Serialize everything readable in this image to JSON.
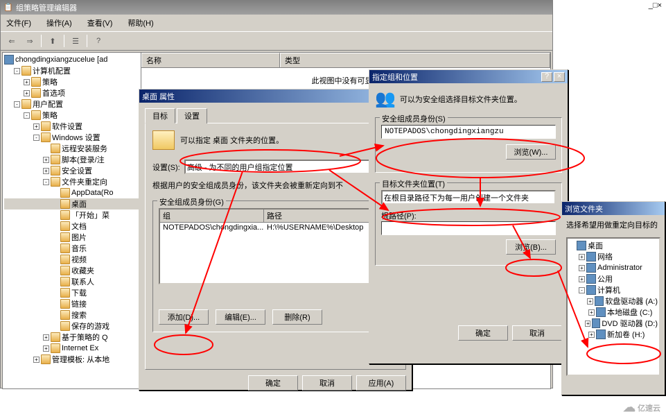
{
  "main_window": {
    "title": "组策略管理编辑器",
    "menubar": [
      "文件(F)",
      "操作(A)",
      "查看(V)",
      "帮助(H)"
    ],
    "win_buttons": {
      "min": "_",
      "max": "□",
      "close": "×"
    }
  },
  "tree": {
    "root": "chongdingxiangzucelue [ad",
    "items": [
      {
        "indent": 1,
        "toggle": "-",
        "label": "计算机配置",
        "icon": "computer"
      },
      {
        "indent": 2,
        "toggle": "+",
        "label": "策略",
        "icon": "folder"
      },
      {
        "indent": 2,
        "toggle": "+",
        "label": "首选项",
        "icon": "folder"
      },
      {
        "indent": 1,
        "toggle": "-",
        "label": "用户配置",
        "icon": "user"
      },
      {
        "indent": 2,
        "toggle": "-",
        "label": "策略",
        "icon": "folder"
      },
      {
        "indent": 3,
        "toggle": "+",
        "label": "软件设置",
        "icon": "folder"
      },
      {
        "indent": 3,
        "toggle": "-",
        "label": "Windows 设置",
        "icon": "folder"
      },
      {
        "indent": 4,
        "toggle": "",
        "label": "远程安装服务",
        "icon": "remote"
      },
      {
        "indent": 4,
        "toggle": "+",
        "label": "脚本(登录/注",
        "icon": "script"
      },
      {
        "indent": 4,
        "toggle": "+",
        "label": "安全设置",
        "icon": "security"
      },
      {
        "indent": 4,
        "toggle": "-",
        "label": "文件夹重定向",
        "icon": "folder"
      },
      {
        "indent": 5,
        "toggle": "",
        "label": "AppData(Ro",
        "icon": "folder"
      },
      {
        "indent": 5,
        "toggle": "",
        "label": "桌面",
        "icon": "folder",
        "selected": true
      },
      {
        "indent": 5,
        "toggle": "",
        "label": "「开始」菜",
        "icon": "folder"
      },
      {
        "indent": 5,
        "toggle": "",
        "label": "文档",
        "icon": "folder"
      },
      {
        "indent": 5,
        "toggle": "",
        "label": "图片",
        "icon": "folder"
      },
      {
        "indent": 5,
        "toggle": "",
        "label": "音乐",
        "icon": "folder"
      },
      {
        "indent": 5,
        "toggle": "",
        "label": "视频",
        "icon": "folder"
      },
      {
        "indent": 5,
        "toggle": "",
        "label": "收藏夹",
        "icon": "folder"
      },
      {
        "indent": 5,
        "toggle": "",
        "label": "联系人",
        "icon": "folder"
      },
      {
        "indent": 5,
        "toggle": "",
        "label": "下载",
        "icon": "folder"
      },
      {
        "indent": 5,
        "toggle": "",
        "label": "链接",
        "icon": "folder"
      },
      {
        "indent": 5,
        "toggle": "",
        "label": "搜索",
        "icon": "folder"
      },
      {
        "indent": 5,
        "toggle": "",
        "label": "保存的游戏",
        "icon": "folder"
      },
      {
        "indent": 4,
        "toggle": "+",
        "label": "基于策略的 Q",
        "icon": "policy"
      },
      {
        "indent": 4,
        "toggle": "+",
        "label": "Internet Ex",
        "icon": "ie"
      },
      {
        "indent": 3,
        "toggle": "+",
        "label": "管理模板: 从本地",
        "icon": "folder"
      }
    ]
  },
  "list": {
    "columns": {
      "name": "名称",
      "type": "类型"
    },
    "empty_text": "此视图中没有可显示"
  },
  "props_dialog": {
    "title": "桌面 属性",
    "tabs": {
      "target": "目标",
      "settings": "设置"
    },
    "desc": "可以指定 桌面 文件夹的位置。",
    "setting_label": "设置(S):",
    "setting_value": "高级 - 为不同的用户组指定位置",
    "redirect_note": "根据用户的安全组成员身份，该文件夹会被重新定向到不",
    "group_label": "安全组成员身份(G)",
    "list_headers": {
      "group": "组",
      "path": "路径"
    },
    "list_row": {
      "group": "NOTEPADOS\\chongdingxia...",
      "path": "H:\\%USERNAME%\\Desktop"
    },
    "buttons": {
      "add": "添加(D)...",
      "edit": "编辑(E)...",
      "delete": "删除(R)",
      "ok": "确定",
      "cancel": "取消",
      "apply": "应用(A)"
    }
  },
  "group_dialog": {
    "title": "指定组和位置",
    "desc": "可以为安全组选择目标文件夹位置。",
    "sec_group_label": "安全组成员身份(S)",
    "sec_group_value": "NOTEPADOS\\chongdingxiangzu",
    "browse1": "浏览(W)...",
    "target_loc_label": "目标文件夹位置(T)",
    "target_loc_value": "在根目录路径下为每一用户创建一个文件夹",
    "root_path_label": "根路径(P):",
    "root_path_value": "",
    "browse2": "浏览(B)...",
    "ok": "确定",
    "cancel": "取消"
  },
  "browse_dialog": {
    "title": "浏览文件夹",
    "desc": "选择希望用做重定向目标的",
    "items": [
      {
        "indent": 0,
        "toggle": "",
        "label": "桌面",
        "icon": "desktop"
      },
      {
        "indent": 1,
        "toggle": "+",
        "label": "网络",
        "icon": "network"
      },
      {
        "indent": 1,
        "toggle": "+",
        "label": "Administrator",
        "icon": "user"
      },
      {
        "indent": 1,
        "toggle": "+",
        "label": "公用",
        "icon": "folder"
      },
      {
        "indent": 1,
        "toggle": "-",
        "label": "计算机",
        "icon": "computer"
      },
      {
        "indent": 2,
        "toggle": "+",
        "label": "软盘驱动器 (A:)",
        "icon": "floppy"
      },
      {
        "indent": 2,
        "toggle": "+",
        "label": "本地磁盘 (C:)",
        "icon": "disk"
      },
      {
        "indent": 2,
        "toggle": "+",
        "label": "DVD 驱动器 (D:)",
        "icon": "dvd"
      },
      {
        "indent": 2,
        "toggle": "+",
        "label": "新加卷 (H:)",
        "icon": "disk"
      }
    ]
  },
  "watermark": "亿速云"
}
